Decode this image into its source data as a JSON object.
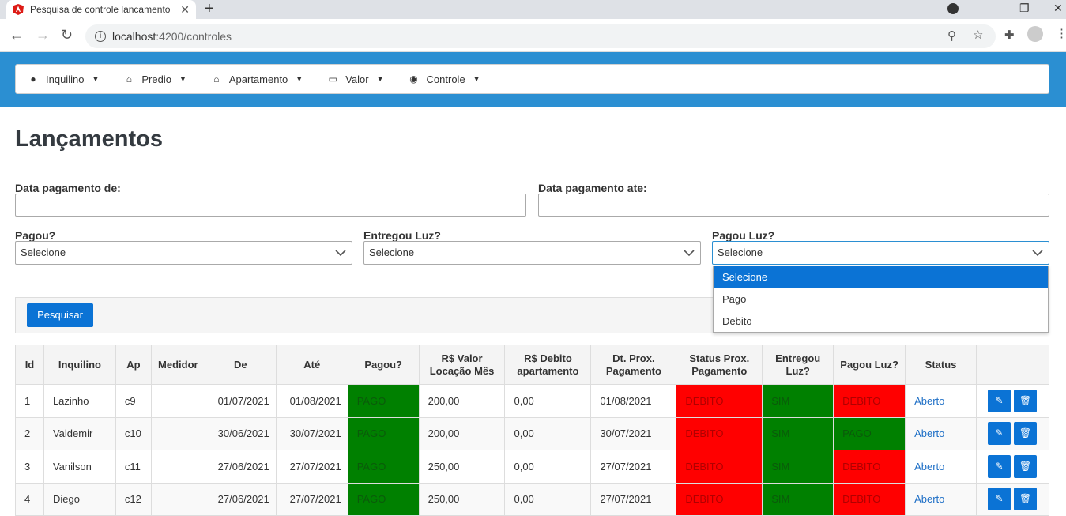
{
  "browser": {
    "tab_title": "Pesquisa de controle lancamento",
    "url_host": "localhost",
    "url_path": ":4200/controles"
  },
  "menu": [
    {
      "label": "Inquilino",
      "icon": "user-icon"
    },
    {
      "label": "Predio",
      "icon": "home-icon"
    },
    {
      "label": "Apartamento",
      "icon": "home-icon"
    },
    {
      "label": "Valor",
      "icon": "money-icon"
    },
    {
      "label": "Controle",
      "icon": "eye-icon"
    }
  ],
  "page_title": "Lançamentos",
  "filters": {
    "data_de_label": "Data pagamento de:",
    "data_ate_label": "Data pagamento ate:",
    "pagou_label": "Pagou?",
    "pagou_value": "Selecione",
    "entregou_label": "Entregou Luz?",
    "entregou_value": "Selecione",
    "pagou_luz_label": "Pagou Luz?",
    "pagou_luz_value": "Selecione",
    "pagou_luz_options": [
      "Selecione",
      "Pago",
      "Debito"
    ]
  },
  "search_button": "Pesquisar",
  "table": {
    "headers": [
      "Id",
      "Inquilino",
      "Ap",
      "Medidor",
      "De",
      "Até",
      "Pagou?",
      "R$ Valor Locação Mês",
      "R$ Debito apartamento",
      "Dt. Prox. Pagamento",
      "Status Prox. Pagamento",
      "Entregou Luz?",
      "Pagou Luz?",
      "Status",
      ""
    ],
    "rows": [
      {
        "id": "1",
        "inquilino": "Lazinho",
        "ap": "c9",
        "medidor": "",
        "de": "01/07/2021",
        "ate": "01/08/2021",
        "pagou": "PAGO",
        "valor": "200,00",
        "debito": "0,00",
        "prox": "01/08/2021",
        "status_prox": "DEBITO",
        "entregou": "SIM",
        "pagou_luz": "DEBITO",
        "status": "Aberto"
      },
      {
        "id": "2",
        "inquilino": "Valdemir",
        "ap": "c10",
        "medidor": "",
        "de": "30/06/2021",
        "ate": "30/07/2021",
        "pagou": "PAGO",
        "valor": "200,00",
        "debito": "0,00",
        "prox": "30/07/2021",
        "status_prox": "DEBITO",
        "entregou": "SIM",
        "pagou_luz": "PAGO",
        "status": "Aberto"
      },
      {
        "id": "3",
        "inquilino": "Vanilson",
        "ap": "c11",
        "medidor": "",
        "de": "27/06/2021",
        "ate": "27/07/2021",
        "pagou": "PAGO",
        "valor": "250,00",
        "debito": "0,00",
        "prox": "27/07/2021",
        "status_prox": "DEBITO",
        "entregou": "SIM",
        "pagou_luz": "DEBITO",
        "status": "Aberto"
      },
      {
        "id": "4",
        "inquilino": "Diego",
        "ap": "c12",
        "medidor": "",
        "de": "27/06/2021",
        "ate": "27/07/2021",
        "pagou": "PAGO",
        "valor": "250,00",
        "debito": "0,00",
        "prox": "27/07/2021",
        "status_prox": "DEBITO",
        "entregou": "SIM",
        "pagou_luz": "DEBITO",
        "status": "Aberto"
      }
    ]
  },
  "colors": {
    "header_blue": "#2b8fd2",
    "primary": "#0b73d5",
    "green": "#008000",
    "red": "#ff0000"
  }
}
